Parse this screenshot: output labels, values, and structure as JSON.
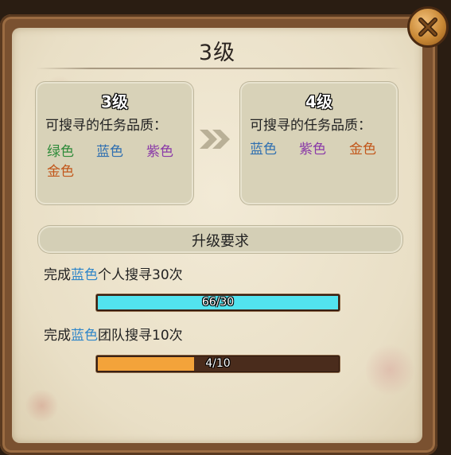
{
  "dialog": {
    "title": "3级"
  },
  "current_level": {
    "title": "3级",
    "subtitle": "可搜寻的任务品质：",
    "qualities": [
      {
        "label": "绿色",
        "color": "#2e8b3a"
      },
      {
        "label": "蓝色",
        "color": "#2f6fb0"
      },
      {
        "label": "紫色",
        "color": "#8a3aa8"
      },
      {
        "label": "金色",
        "color": "#c2571b"
      }
    ]
  },
  "next_level": {
    "title": "4级",
    "subtitle": "可搜寻的任务品质：",
    "qualities": [
      {
        "label": "蓝色",
        "color": "#2f6fb0"
      },
      {
        "label": "紫色",
        "color": "#8a3aa8"
      },
      {
        "label": "金色",
        "color": "#c2571b"
      }
    ]
  },
  "requirements": {
    "title": "升级要求",
    "tasks": [
      {
        "prefix": "完成",
        "highlight": "蓝色",
        "suffix": "个人搜寻30次",
        "progress_text": "66/30",
        "progress_fraction": 1.0,
        "bar_color": "#52e3ef"
      },
      {
        "prefix": "完成",
        "highlight": "蓝色",
        "suffix": "团队搜寻10次",
        "progress_text": "4/10",
        "progress_fraction": 0.4,
        "bar_color": "#f3a33a"
      }
    ]
  },
  "icons": {
    "close": "close-icon",
    "arrows": "double-chevron-right-icon"
  }
}
